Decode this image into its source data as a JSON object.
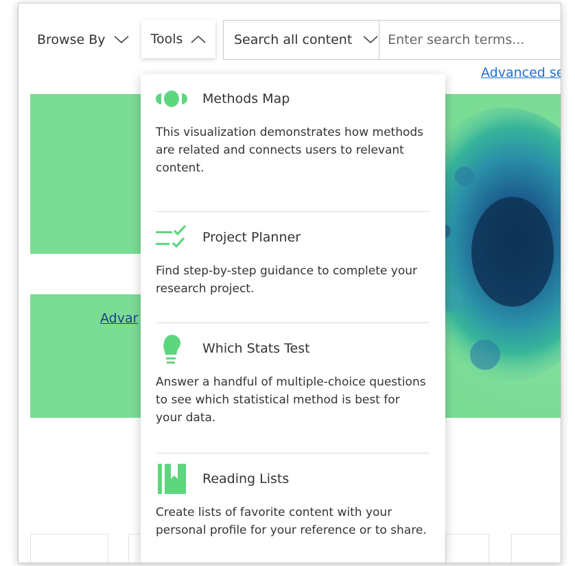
{
  "nav": {
    "browse_label": "Browse By",
    "tools_label": "Tools",
    "search_scope": "Search all content",
    "search_placeholder": "Enter search terms...",
    "advanced_search_top": "Advanced se",
    "advanced_search_left": "Advar"
  },
  "tools_menu": [
    {
      "title": "Methods Map",
      "icon": "methods-map-icon",
      "description": "This visualization demonstrates how methods are related and connects users to relevant content."
    },
    {
      "title": "Project Planner",
      "icon": "checklist-icon",
      "description": "Find step-by-step guidance to complete your research project."
    },
    {
      "title": "Which Stats Test",
      "icon": "lightbulb-icon",
      "description": "Answer a handful of multiple-choice questions to see which statistical method is best for your data."
    },
    {
      "title": "Reading Lists",
      "icon": "bookmark-book-icon",
      "description": "Create lists of favorite content with your personal profile for your reference or to share."
    }
  ],
  "colors": {
    "accent_green": "#7bdc96",
    "icon_green": "#5ed67f",
    "link_blue": "#1a6fd6",
    "text_dark": "#333333"
  }
}
